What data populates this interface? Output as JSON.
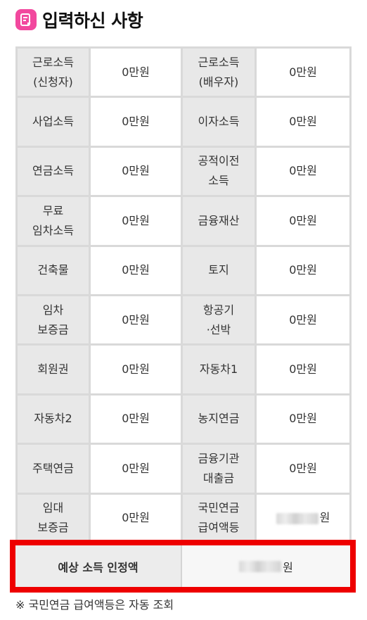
{
  "header": {
    "title": "입력하신 사항",
    "icon": "document-icon",
    "icon_color": "#f2489e"
  },
  "rows": [
    {
      "l1": "근로소득\n(신청자)",
      "v1": "0만원",
      "l2": "근로소득\n(배우자)",
      "v2": "0만원"
    },
    {
      "l1": "사업소득",
      "v1": "0만원",
      "l2": "이자소득",
      "v2": "0만원"
    },
    {
      "l1": "연금소득",
      "v1": "0만원",
      "l2": "공적이전\n소득",
      "v2": "0만원"
    },
    {
      "l1": "무료\n임차소득",
      "v1": "0만원",
      "l2": "금융재산",
      "v2": "0만원"
    },
    {
      "l1": "건축물",
      "v1": "0만원",
      "l2": "토지",
      "v2": "0만원"
    },
    {
      "l1": "임차\n보증금",
      "v1": "0만원",
      "l2": "항공기\n·선박",
      "v2": "0만원"
    },
    {
      "l1": "회원권",
      "v1": "0만원",
      "l2": "자동차1",
      "v2": "0만원"
    },
    {
      "l1": "자동차2",
      "v1": "0만원",
      "l2": "농지연금",
      "v2": "0만원"
    },
    {
      "l1": "주택연금",
      "v1": "0만원",
      "l2": "금융기관\n대출금",
      "v2": "0만원"
    },
    {
      "l1": "임대\n보증금",
      "v1": "0만원",
      "l2": "국민연금\n급여액등",
      "v2": "원"
    }
  ],
  "estimate": {
    "label": "예상 소득 인정액",
    "unit": "원",
    "highlight_color": "#ee0000"
  },
  "footnote": "※ 국민연금 급여액등은 자동 조회"
}
